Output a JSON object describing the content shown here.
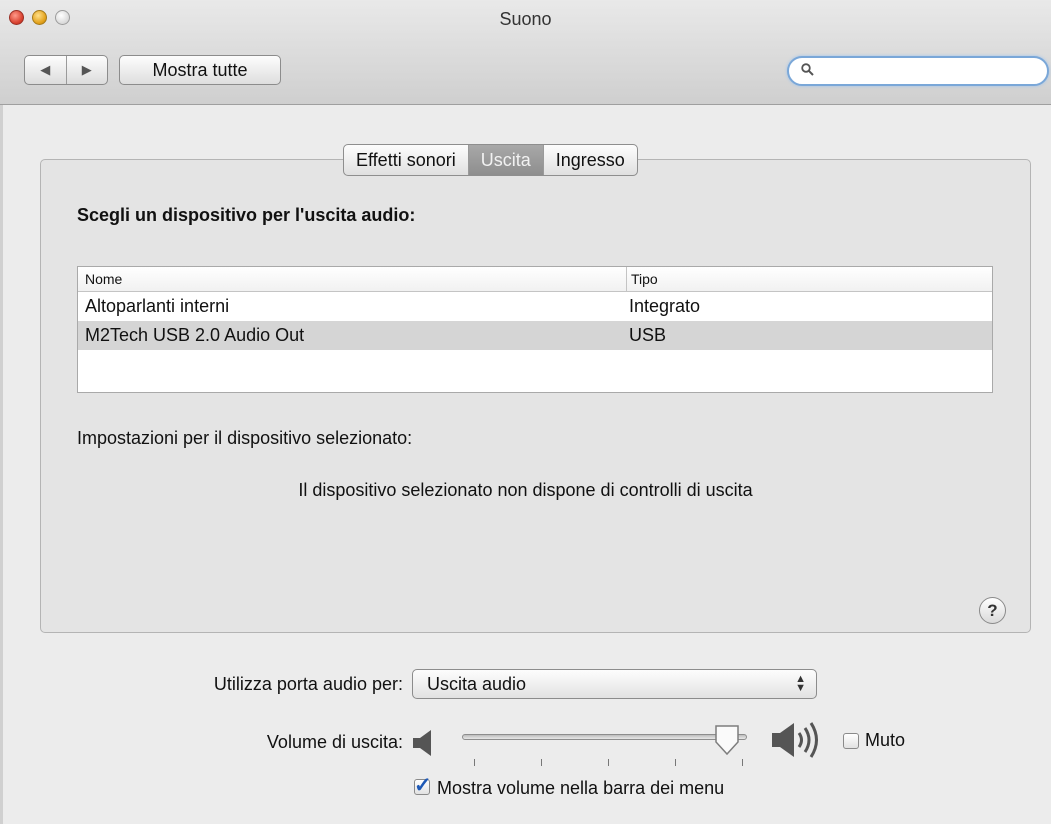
{
  "window": {
    "title": "Suono"
  },
  "toolbar": {
    "back_label": "◀",
    "forward_label": "▶",
    "show_all_label": "Mostra tutte",
    "search_value": ""
  },
  "tabs": [
    {
      "label": "Effetti sonori",
      "selected": false
    },
    {
      "label": "Uscita",
      "selected": true
    },
    {
      "label": "Ingresso",
      "selected": false
    }
  ],
  "output": {
    "heading": "Scegli un dispositivo per l'uscita audio:",
    "columns": [
      "Nome",
      "Tipo"
    ],
    "devices": [
      {
        "name": "Altoparlanti interni",
        "type": "Integrato",
        "selected": false
      },
      {
        "name": "M2Tech USB 2.0 Audio Out",
        "type": "USB",
        "selected": true
      }
    ],
    "settings_label": "Impostazioni per il dispositivo selezionato:",
    "no_controls_text": "Il dispositivo selezionato non dispone di controlli di uscita",
    "help_label": "?"
  },
  "footer": {
    "audio_port_label": "Utilizza porta audio per:",
    "audio_port_value": "Uscita audio",
    "volume_label": "Volume di uscita:",
    "volume_level": 0.93,
    "mute_label": "Muto",
    "mute_checked": false,
    "show_in_menubar_label": "Mostra volume nella barra dei menu",
    "show_in_menubar_checked": true
  }
}
